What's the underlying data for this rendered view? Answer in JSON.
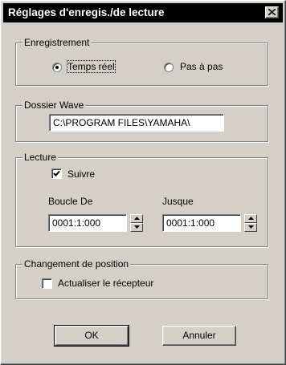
{
  "window": {
    "title": "Réglages d'enregis./de lecture",
    "close_icon": "close-icon"
  },
  "recording": {
    "group_label": "Enregistrement",
    "options": [
      {
        "label": "Temps réel",
        "selected": true
      },
      {
        "label": "Pas à pas",
        "selected": false
      }
    ]
  },
  "wave_folder": {
    "group_label": "Dossier Wave",
    "value": "C:\\PROGRAM FILES\\YAMAHA\\"
  },
  "playback": {
    "group_label": "Lecture",
    "follow": {
      "label": "Suivre",
      "checked": true
    },
    "loop_from": {
      "label": "Boucle De",
      "value": "0001:1:000"
    },
    "loop_to": {
      "label": "Jusque",
      "value": "0001:1:000"
    }
  },
  "position_change": {
    "group_label": "Changement de position",
    "update_receiver": {
      "label": "Actualiser le récepteur",
      "checked": false
    }
  },
  "buttons": {
    "ok": "OK",
    "cancel": "Annuler"
  }
}
